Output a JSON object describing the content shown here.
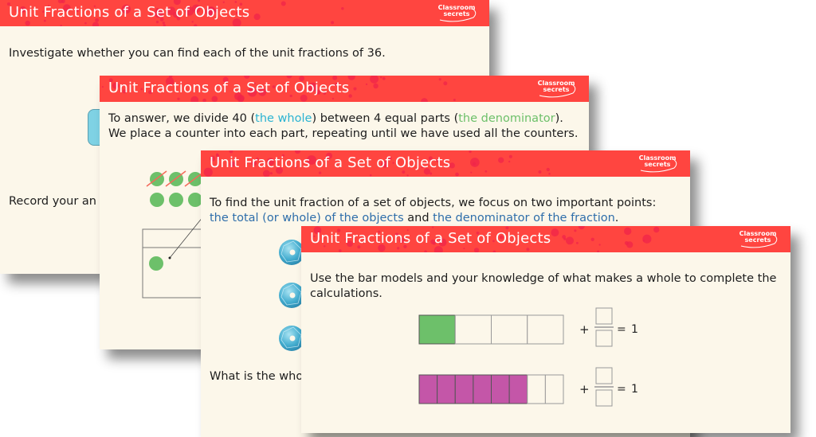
{
  "brand": {
    "logo_line1": "Classroom",
    "logo_line2": "secrets",
    "header_color": "#ff4540",
    "background_color": "#fcf7ea"
  },
  "slides": [
    {
      "title": "Unit Fractions of a Set of Objects",
      "body": "Investigate whether you can find each of the unit fractions of 36.",
      "footer_text": "Record your an"
    },
    {
      "title": "Unit Fractions of a Set of Objects",
      "body_parts": [
        {
          "text": "To answer, we divide 40 (",
          "style": "normal"
        },
        {
          "text": "the whole",
          "style": "teal"
        },
        {
          "text": ") between 4 equal parts (",
          "style": "normal"
        },
        {
          "text": "the denominator",
          "style": "green"
        },
        {
          "text": "). We place a counter into each part, repeating until we have used all the counters.",
          "style": "normal"
        }
      ],
      "counters_crossed": 3,
      "counters_row2": 3
    },
    {
      "title": "Unit Fractions of a Set of Objects",
      "body_intro": "To find the unit fraction of a set of objects, we focus on two important points:",
      "highlight1": "the total (or whole) of the objects",
      "connector": "and",
      "highlight2": "the denominator of the fraction",
      "end": ".",
      "sequin_count": 3,
      "question": "What is the who"
    },
    {
      "title": "Unit Fractions of a Set of Objects",
      "body": "Use the bar models and your knowledge of what makes a whole to complete the calculations.",
      "bar_models": [
        {
          "parts": 4,
          "shaded": 1,
          "color": "#6dc06a",
          "plus": "+",
          "equals": "=",
          "result": "1"
        },
        {
          "parts": 8,
          "shaded": 6,
          "color": "#c456a8",
          "plus": "+",
          "equals": "=",
          "result": "1"
        }
      ]
    }
  ]
}
